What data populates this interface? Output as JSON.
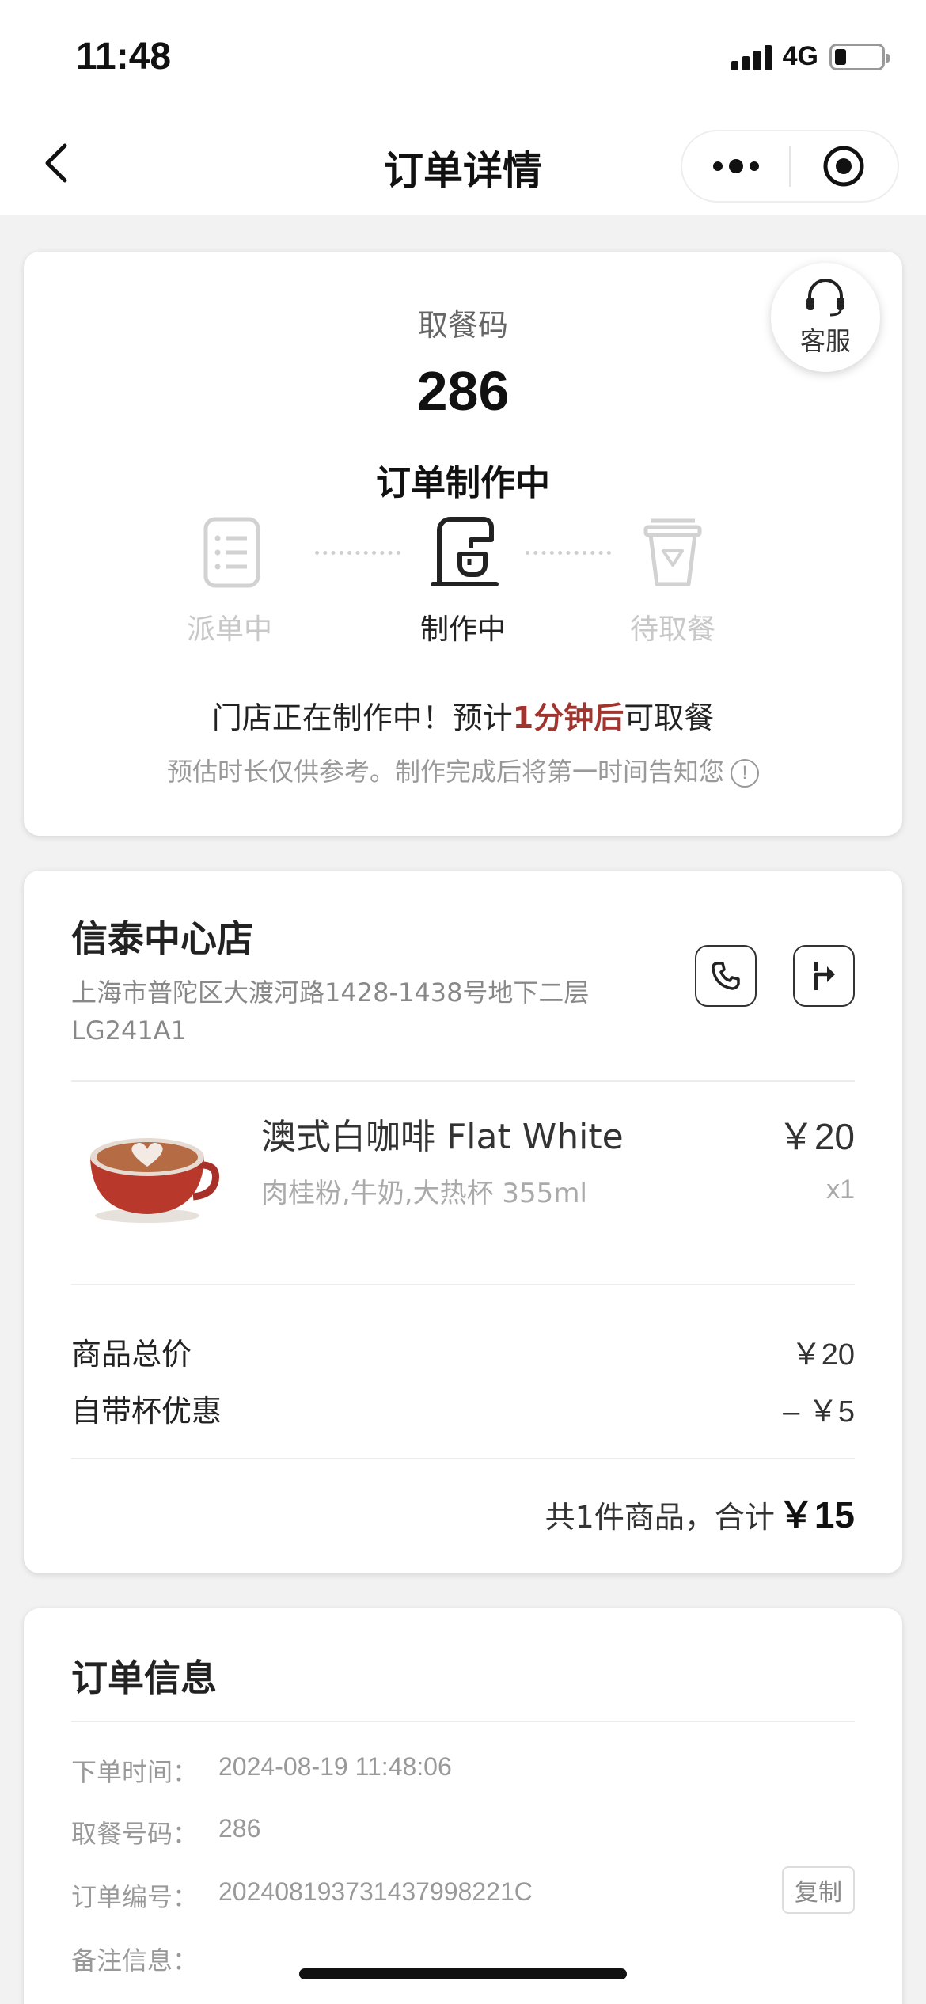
{
  "status_bar": {
    "time": "11:48",
    "network": "4G",
    "battery_level": 0.25
  },
  "nav": {
    "title": "订单详情"
  },
  "order_status": {
    "service_label": "客服",
    "pickup_label": "取餐码",
    "pickup_code": "286",
    "status_title": "订单制作中",
    "steps": [
      {
        "label": "派单中",
        "active": false
      },
      {
        "label": "制作中",
        "active": true
      },
      {
        "label": "待取餐",
        "active": false
      }
    ],
    "message_prefix": "门店正在制作中！预计",
    "message_highlight": "1分钟后",
    "message_suffix": "可取餐",
    "note": "预估时长仅供参考。制作完成后将第一时间告知您",
    "highlight_color": "#a0352f"
  },
  "store": {
    "name": "信泰中心店",
    "address": "上海市普陀区大渡河路1428-1438号地下二层LG241A1"
  },
  "product": {
    "name": "澳式白咖啡 Flat White",
    "spec": "肉桂粉,牛奶,大热杯 355ml",
    "price": "￥20",
    "qty": "x1"
  },
  "summary": {
    "subtotal_label": "商品总价",
    "subtotal_value": "￥20",
    "discount_label": "自带杯优惠",
    "discount_value": "– ￥5",
    "total_prefix": "共1件商品，合计",
    "total_value": "￥15"
  },
  "order_info": {
    "title": "订单信息",
    "rows": [
      {
        "key": "下单时间：",
        "value": "2024-08-19 11:48:06"
      },
      {
        "key": "取餐号码：",
        "value": "286"
      },
      {
        "key": "订单编号：",
        "value": "20240819373143799822​1C"
      },
      {
        "key": "备注信息：",
        "value": ""
      }
    ],
    "copy_label": "复制"
  }
}
